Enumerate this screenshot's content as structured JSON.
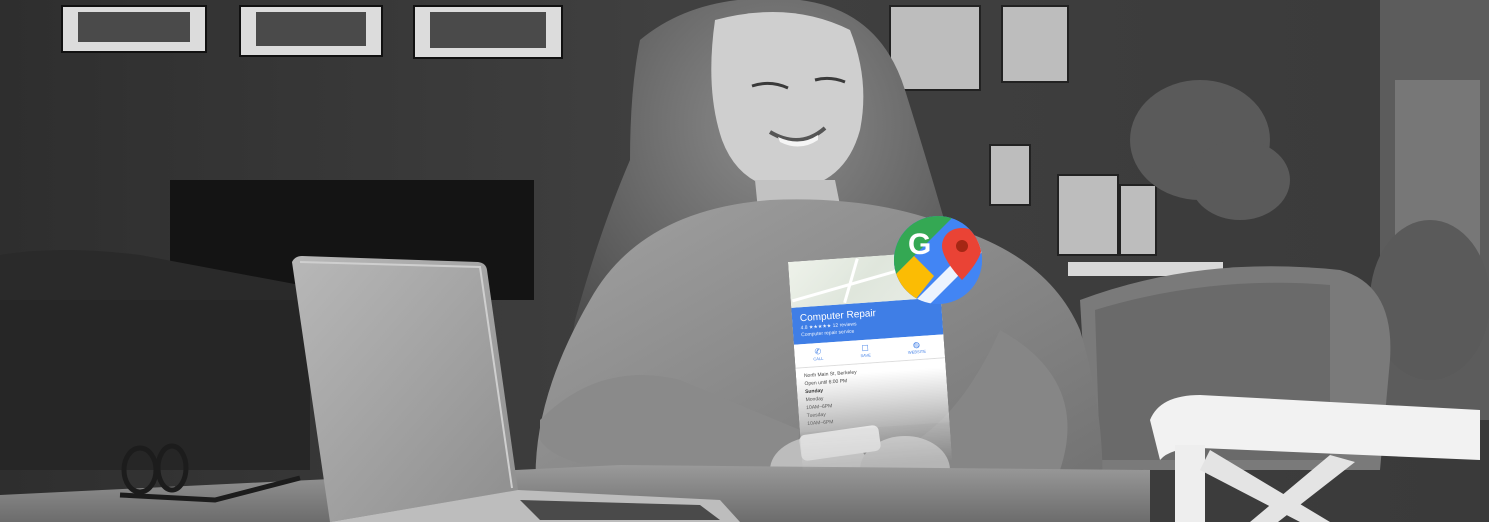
{
  "listing": {
    "business_name": "Computer Repair",
    "rating_line": "4.8 ★★★★★ 12 reviews",
    "category": "Computer repair service",
    "actions": [
      {
        "label": "CALL",
        "icon": "phone-icon"
      },
      {
        "label": "SAVE",
        "icon": "bookmark-icon"
      },
      {
        "label": "WEBSITE",
        "icon": "globe-icon"
      }
    ],
    "address": "North Main St, Berkeley",
    "open_status": "Open until 6:00 PM",
    "hours": [
      {
        "day": "Sunday",
        "time": ""
      },
      {
        "day": "Monday",
        "time": "10AM–6PM"
      },
      {
        "day": "Tuesday",
        "time": "10AM–6PM"
      }
    ]
  },
  "logo": {
    "letter": "G",
    "colors": {
      "green": "#34a853",
      "yellow": "#fbbc04",
      "blue": "#4285f4",
      "red": "#ea4335",
      "white": "#ffffff"
    }
  },
  "scene": {
    "palette": {
      "wall": "#3a3a3a",
      "table": "#8a8a8a",
      "sweater": "#8f8f8f",
      "laptop": "#a9a9a9",
      "chair": "#f2f2f2"
    }
  }
}
